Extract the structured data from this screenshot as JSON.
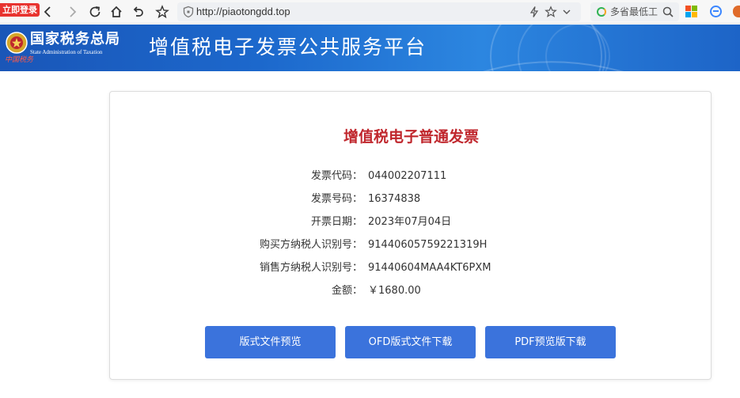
{
  "browser": {
    "login_badge": "立即登录",
    "url": "http://piaotongdd.top",
    "search_text": "多省最低工"
  },
  "banner": {
    "agency_cn": "国家税务总局",
    "agency_en": "State Administration of Taxation",
    "seal_text": "中国税务",
    "platform_title": "增值税电子发票公共服务平台"
  },
  "invoice": {
    "title": "增值税电子普通发票",
    "fields": [
      {
        "label": "发票代码：",
        "value": "044002207111"
      },
      {
        "label": "发票号码：",
        "value": "16374838"
      },
      {
        "label": "开票日期：",
        "value": "2023年07月04日"
      },
      {
        "label": "购买方纳税人识别号：",
        "value": "91440605759221319H"
      },
      {
        "label": "销售方纳税人识别号：",
        "value": "91440604MAA4KT6PXM"
      },
      {
        "label": "金额：",
        "value": "￥1680.00"
      }
    ]
  },
  "actions": {
    "preview_label": "版式文件预览",
    "ofd_download_label": "OFD版式文件下载",
    "pdf_download_label": "PDF预览版下载"
  },
  "colors": {
    "banner_blue": "#1c68cc",
    "title_red": "#c0272d",
    "button_blue": "#3b73dc"
  }
}
